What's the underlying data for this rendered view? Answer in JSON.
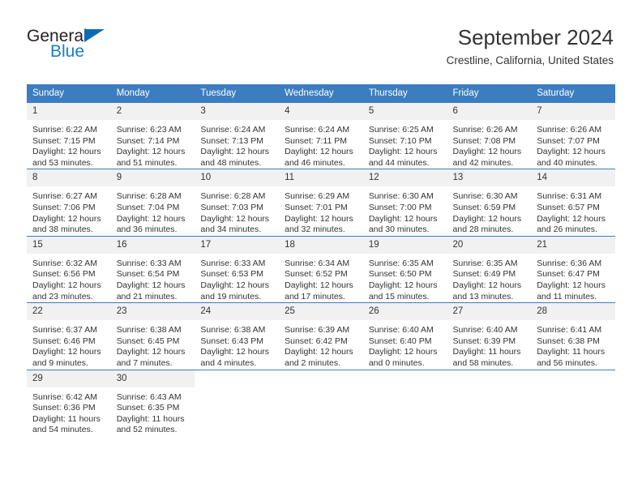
{
  "brand": {
    "name_top": "General",
    "name_bottom": "Blue",
    "accent_color": "#1a7fc1",
    "triangle_color": "#0b6cb5"
  },
  "header": {
    "title": "September 2024",
    "subtitle": "Crestline, California, United States"
  },
  "theme": {
    "header_bg": "#3b7dbf",
    "header_text": "#ffffff",
    "daynum_band_bg": "#f1f1f1",
    "row_divider": "#3b7dbf",
    "body_text": "#333333"
  },
  "calendar": {
    "weekday_headers": [
      "Sunday",
      "Monday",
      "Tuesday",
      "Wednesday",
      "Thursday",
      "Friday",
      "Saturday"
    ],
    "weeks": [
      [
        {
          "day": "1",
          "sunrise": "Sunrise: 6:22 AM",
          "sunset": "Sunset: 7:15 PM",
          "daylight": "Daylight: 12 hours and 53 minutes."
        },
        {
          "day": "2",
          "sunrise": "Sunrise: 6:23 AM",
          "sunset": "Sunset: 7:14 PM",
          "daylight": "Daylight: 12 hours and 51 minutes."
        },
        {
          "day": "3",
          "sunrise": "Sunrise: 6:24 AM",
          "sunset": "Sunset: 7:13 PM",
          "daylight": "Daylight: 12 hours and 48 minutes."
        },
        {
          "day": "4",
          "sunrise": "Sunrise: 6:24 AM",
          "sunset": "Sunset: 7:11 PM",
          "daylight": "Daylight: 12 hours and 46 minutes."
        },
        {
          "day": "5",
          "sunrise": "Sunrise: 6:25 AM",
          "sunset": "Sunset: 7:10 PM",
          "daylight": "Daylight: 12 hours and 44 minutes."
        },
        {
          "day": "6",
          "sunrise": "Sunrise: 6:26 AM",
          "sunset": "Sunset: 7:08 PM",
          "daylight": "Daylight: 12 hours and 42 minutes."
        },
        {
          "day": "7",
          "sunrise": "Sunrise: 6:26 AM",
          "sunset": "Sunset: 7:07 PM",
          "daylight": "Daylight: 12 hours and 40 minutes."
        }
      ],
      [
        {
          "day": "8",
          "sunrise": "Sunrise: 6:27 AM",
          "sunset": "Sunset: 7:06 PM",
          "daylight": "Daylight: 12 hours and 38 minutes."
        },
        {
          "day": "9",
          "sunrise": "Sunrise: 6:28 AM",
          "sunset": "Sunset: 7:04 PM",
          "daylight": "Daylight: 12 hours and 36 minutes."
        },
        {
          "day": "10",
          "sunrise": "Sunrise: 6:28 AM",
          "sunset": "Sunset: 7:03 PM",
          "daylight": "Daylight: 12 hours and 34 minutes."
        },
        {
          "day": "11",
          "sunrise": "Sunrise: 6:29 AM",
          "sunset": "Sunset: 7:01 PM",
          "daylight": "Daylight: 12 hours and 32 minutes."
        },
        {
          "day": "12",
          "sunrise": "Sunrise: 6:30 AM",
          "sunset": "Sunset: 7:00 PM",
          "daylight": "Daylight: 12 hours and 30 minutes."
        },
        {
          "day": "13",
          "sunrise": "Sunrise: 6:30 AM",
          "sunset": "Sunset: 6:59 PM",
          "daylight": "Daylight: 12 hours and 28 minutes."
        },
        {
          "day": "14",
          "sunrise": "Sunrise: 6:31 AM",
          "sunset": "Sunset: 6:57 PM",
          "daylight": "Daylight: 12 hours and 26 minutes."
        }
      ],
      [
        {
          "day": "15",
          "sunrise": "Sunrise: 6:32 AM",
          "sunset": "Sunset: 6:56 PM",
          "daylight": "Daylight: 12 hours and 23 minutes."
        },
        {
          "day": "16",
          "sunrise": "Sunrise: 6:33 AM",
          "sunset": "Sunset: 6:54 PM",
          "daylight": "Daylight: 12 hours and 21 minutes."
        },
        {
          "day": "17",
          "sunrise": "Sunrise: 6:33 AM",
          "sunset": "Sunset: 6:53 PM",
          "daylight": "Daylight: 12 hours and 19 minutes."
        },
        {
          "day": "18",
          "sunrise": "Sunrise: 6:34 AM",
          "sunset": "Sunset: 6:52 PM",
          "daylight": "Daylight: 12 hours and 17 minutes."
        },
        {
          "day": "19",
          "sunrise": "Sunrise: 6:35 AM",
          "sunset": "Sunset: 6:50 PM",
          "daylight": "Daylight: 12 hours and 15 minutes."
        },
        {
          "day": "20",
          "sunrise": "Sunrise: 6:35 AM",
          "sunset": "Sunset: 6:49 PM",
          "daylight": "Daylight: 12 hours and 13 minutes."
        },
        {
          "day": "21",
          "sunrise": "Sunrise: 6:36 AM",
          "sunset": "Sunset: 6:47 PM",
          "daylight": "Daylight: 12 hours and 11 minutes."
        }
      ],
      [
        {
          "day": "22",
          "sunrise": "Sunrise: 6:37 AM",
          "sunset": "Sunset: 6:46 PM",
          "daylight": "Daylight: 12 hours and 9 minutes."
        },
        {
          "day": "23",
          "sunrise": "Sunrise: 6:38 AM",
          "sunset": "Sunset: 6:45 PM",
          "daylight": "Daylight: 12 hours and 7 minutes."
        },
        {
          "day": "24",
          "sunrise": "Sunrise: 6:38 AM",
          "sunset": "Sunset: 6:43 PM",
          "daylight": "Daylight: 12 hours and 4 minutes."
        },
        {
          "day": "25",
          "sunrise": "Sunrise: 6:39 AM",
          "sunset": "Sunset: 6:42 PM",
          "daylight": "Daylight: 12 hours and 2 minutes."
        },
        {
          "day": "26",
          "sunrise": "Sunrise: 6:40 AM",
          "sunset": "Sunset: 6:40 PM",
          "daylight": "Daylight: 12 hours and 0 minutes."
        },
        {
          "day": "27",
          "sunrise": "Sunrise: 6:40 AM",
          "sunset": "Sunset: 6:39 PM",
          "daylight": "Daylight: 11 hours and 58 minutes."
        },
        {
          "day": "28",
          "sunrise": "Sunrise: 6:41 AM",
          "sunset": "Sunset: 6:38 PM",
          "daylight": "Daylight: 11 hours and 56 minutes."
        }
      ],
      [
        {
          "day": "29",
          "sunrise": "Sunrise: 6:42 AM",
          "sunset": "Sunset: 6:36 PM",
          "daylight": "Daylight: 11 hours and 54 minutes."
        },
        {
          "day": "30",
          "sunrise": "Sunrise: 6:43 AM",
          "sunset": "Sunset: 6:35 PM",
          "daylight": "Daylight: 11 hours and 52 minutes."
        },
        null,
        null,
        null,
        null,
        null
      ]
    ]
  }
}
